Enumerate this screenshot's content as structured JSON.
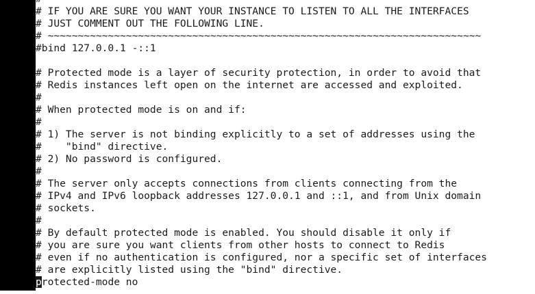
{
  "colors": {
    "background": "#ffffff",
    "text": "#1a1a1a",
    "margin": "#000000",
    "cursor": "#1a1a1a"
  },
  "editor": {
    "lines": [
      "#",
      "# IF YOU ARE SURE YOU WANT YOUR INSTANCE TO LISTEN TO ALL THE INTERFACES",
      "# JUST COMMENT OUT THE FOLLOWING LINE.",
      "# ~~~~~~~~~~~~~~~~~~~~~~~~~~~~~~~~~~~~~~~~~~~~~~~~~~~~~~~~~~~~~~~~~~~~~~~~",
      "#bind 127.0.0.1 -::1",
      "",
      "# Protected mode is a layer of security protection, in order to avoid that",
      "# Redis instances left open on the internet are accessed and exploited.",
      "#",
      "# When protected mode is on and if:",
      "#",
      "# 1) The server is not binding explicitly to a set of addresses using the",
      "#    \"bind\" directive.",
      "# 2) No password is configured.",
      "#",
      "# The server only accepts connections from clients connecting from the",
      "# IPv4 and IPv6 loopback addresses 127.0.0.1 and ::1, and from Unix domain",
      "# sockets.",
      "#",
      "# By default protected mode is enabled. You should disable it only if",
      "# you are sure you want clients from other hosts to connect to Redis",
      "# even if no authentication is configured, nor a specific set of interfaces",
      "# are explicitly listed using the \"bind\" directive."
    ],
    "cursor_line": {
      "cursor_char": "p",
      "rest": "rotected-mode no"
    }
  }
}
